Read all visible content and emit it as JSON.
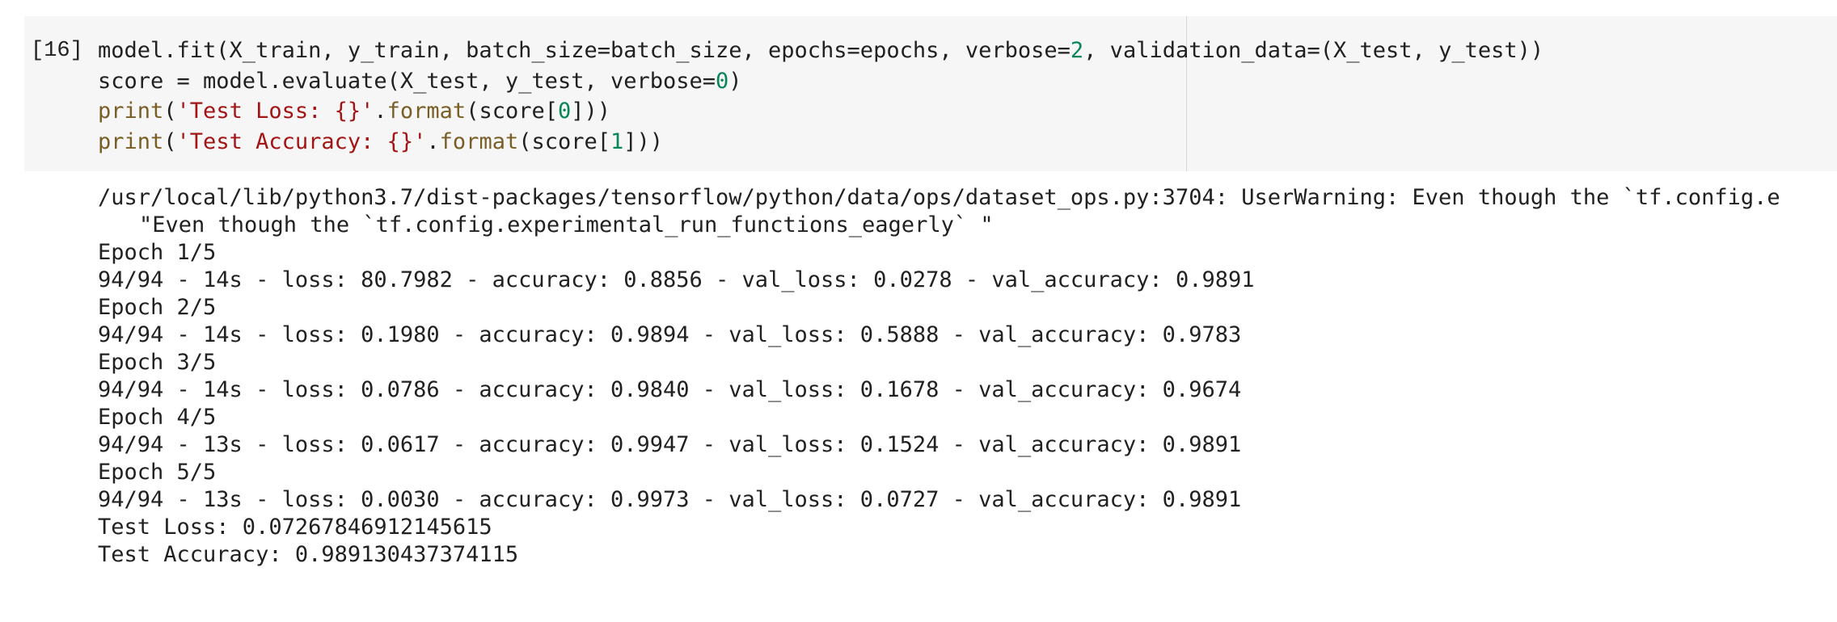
{
  "cell": {
    "execution_count": "[16]",
    "code_lines": [
      [
        {
          "t": "model.fit(X_train, y_train, batch_size=batch_size, epochs=epochs, verbose=",
          "k": "plain"
        },
        {
          "t": "2",
          "k": "num"
        },
        {
          "t": ", validation_data=(X_test, y_test))",
          "k": "plain"
        }
      ],
      [
        {
          "t": "score = model.evaluate(X_test, y_test, verbose=",
          "k": "plain"
        },
        {
          "t": "0",
          "k": "num"
        },
        {
          "t": ")",
          "k": "plain"
        }
      ],
      [
        {
          "t": "print",
          "k": "builtin"
        },
        {
          "t": "(",
          "k": "plain"
        },
        {
          "t": "'Test Loss: {}'",
          "k": "str"
        },
        {
          "t": ".",
          "k": "plain"
        },
        {
          "t": "format",
          "k": "builtin"
        },
        {
          "t": "(score[",
          "k": "plain"
        },
        {
          "t": "0",
          "k": "num"
        },
        {
          "t": "]))",
          "k": "plain"
        }
      ],
      [
        {
          "t": "print",
          "k": "builtin"
        },
        {
          "t": "(",
          "k": "plain"
        },
        {
          "t": "'Test Accuracy: {}'",
          "k": "str"
        },
        {
          "t": ".",
          "k": "plain"
        },
        {
          "t": "format",
          "k": "builtin"
        },
        {
          "t": "(score[",
          "k": "plain"
        },
        {
          "t": "1",
          "k": "num"
        },
        {
          "t": "]))",
          "k": "plain"
        }
      ]
    ]
  },
  "output": {
    "warning_line": "/usr/local/lib/python3.7/dist-packages/tensorflow/python/data/ops/dataset_ops.py:3704: UserWarning: Even though the `tf.config.e",
    "warning_continuation": "\"Even though the `tf.config.experimental_run_functions_eagerly` \"",
    "epoch_1_header": "Epoch 1/5",
    "epoch_1_log": "94/94 - 14s - loss: 80.7982 - accuracy: 0.8856 - val_loss: 0.0278 - val_accuracy: 0.9891",
    "epoch_2_header": "Epoch 2/5",
    "epoch_2_log": "94/94 - 14s - loss: 0.1980 - accuracy: 0.9894 - val_loss: 0.5888 - val_accuracy: 0.9783",
    "epoch_3_header": "Epoch 3/5",
    "epoch_3_log": "94/94 - 14s - loss: 0.0786 - accuracy: 0.9840 - val_loss: 0.1678 - val_accuracy: 0.9674",
    "epoch_4_header": "Epoch 4/5",
    "epoch_4_log": "94/94 - 13s - loss: 0.0617 - accuracy: 0.9947 - val_loss: 0.1524 - val_accuracy: 0.9891",
    "epoch_5_header": "Epoch 5/5",
    "epoch_5_log": "94/94 - 13s - loss: 0.0030 - accuracy: 0.9973 - val_loss: 0.0727 - val_accuracy: 0.9891",
    "test_loss": "Test Loss: 0.07267846912145615",
    "test_accuracy": "Test Accuracy: 0.989130437374115"
  },
  "colors": {
    "input_background": "#f6f6f6",
    "text": "#212121",
    "builtin": "#795e26",
    "string": "#a31515",
    "number": "#098658"
  }
}
